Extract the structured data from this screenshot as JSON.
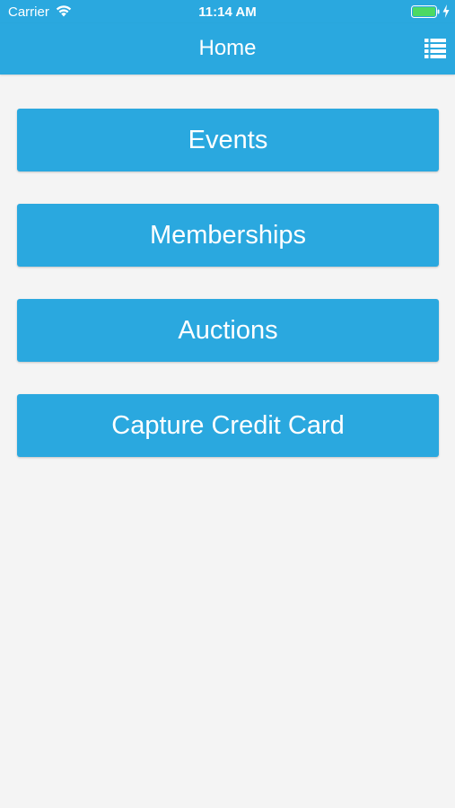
{
  "status_bar": {
    "carrier": "Carrier",
    "time": "11:14 AM",
    "wifi_icon": "wifi-icon",
    "battery_icon": "battery-icon",
    "battery_color": "#4cd964",
    "charging_icon": "charging-bolt-icon"
  },
  "nav": {
    "title": "Home",
    "menu_icon": "list-icon"
  },
  "colors": {
    "accent": "#2aa8df",
    "background": "#f4f4f4",
    "text_on_accent": "#ffffff"
  },
  "menu": {
    "items": [
      {
        "label": "Events"
      },
      {
        "label": "Memberships"
      },
      {
        "label": "Auctions"
      },
      {
        "label": "Capture Credit Card"
      }
    ]
  }
}
